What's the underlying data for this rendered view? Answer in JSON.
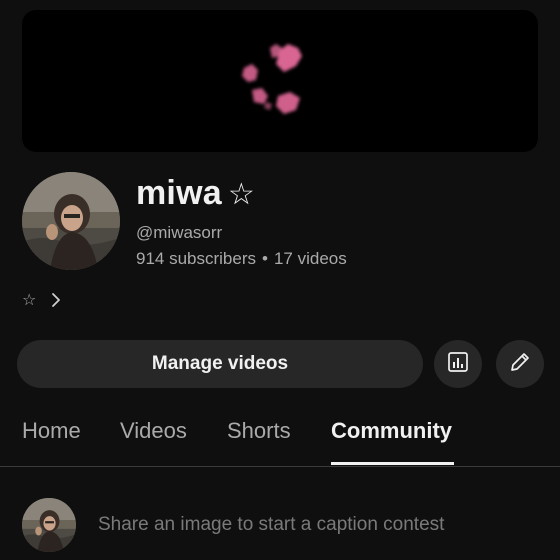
{
  "channel": {
    "name": "miwa",
    "name_star": "☆",
    "handle": "@miwasorr",
    "subscribers": "914 subscribers",
    "separator": "•",
    "videos": "17 videos",
    "description_star": "☆"
  },
  "actions": {
    "manage_label": "Manage videos"
  },
  "tabs": [
    {
      "label": "Home"
    },
    {
      "label": "Videos"
    },
    {
      "label": "Shorts"
    },
    {
      "label": "Community"
    }
  ],
  "community": {
    "placeholder": "Share an image to start a caption contest"
  },
  "icons": {
    "analytics": "analytics-icon",
    "edit": "pencil-icon",
    "chevron": "chevron-right-icon"
  },
  "colors": {
    "background": "#0f0f0f",
    "surface": "#272727",
    "text_primary": "#f1f1f1",
    "text_secondary": "#aaaaaa",
    "banner_accent": "#e56a9a"
  }
}
